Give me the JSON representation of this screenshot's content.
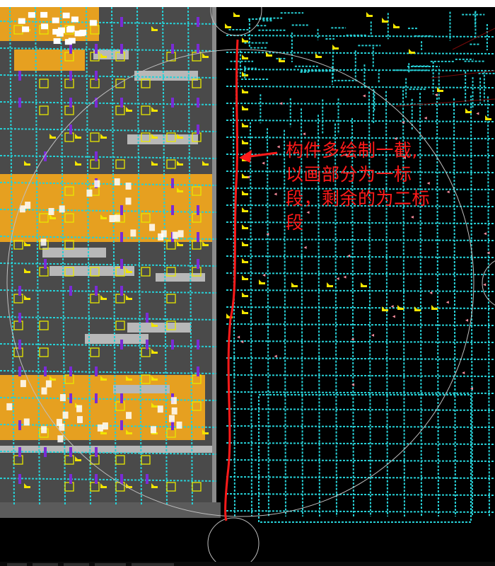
{
  "window": {
    "title_bar_color": "#ffffff"
  },
  "canvas": {
    "background": "#000000",
    "colors": {
      "grid_line": "#27d0d6",
      "building_floor": "#4a4a4a",
      "building_frame": "#8a8a8a",
      "orange_block": "#e6a020",
      "purple_column": "#7a2bd6",
      "yellow_marker": "#f2e400",
      "gray_beam": "#b8b8b8",
      "yellow_box": "#e8e800",
      "pink_marker": "#ff8fa0",
      "boundary_arc": "#bfbfbf",
      "dark_red_line": "#7a0a0a",
      "divider_line": "#ff1a1a"
    }
  },
  "annotation": {
    "lines": [
      "构件多绘制一截,",
      "以画部分为一标",
      "段，剩余的为二标",
      "段"
    ],
    "color": "#ff1a1a"
  },
  "icons": {
    "divider": "red-divider-line",
    "arrow": "red-arrow-icon"
  }
}
